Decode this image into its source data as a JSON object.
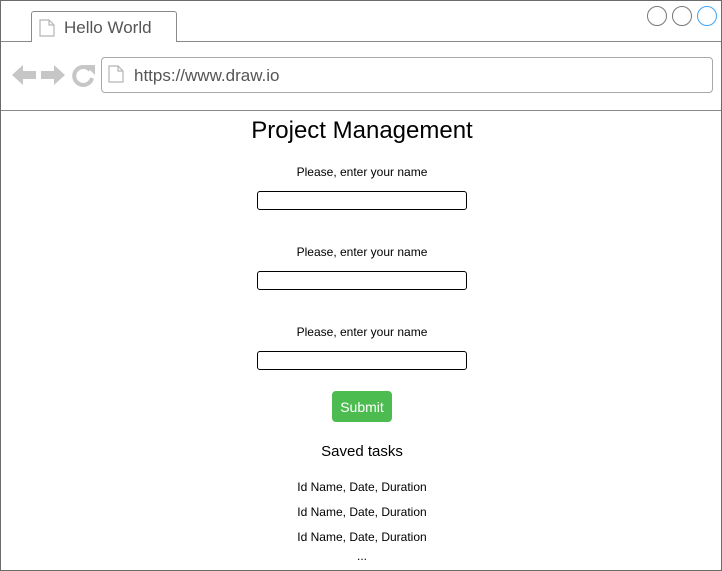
{
  "browser": {
    "tab_title": "Hello World",
    "url": "https://www.draw.io",
    "icons": {
      "tab": "document-icon",
      "back": "back-arrow-icon",
      "forward": "forward-arrow-icon",
      "reload": "reload-icon",
      "url": "document-icon"
    },
    "window_controls": [
      "minimize-button",
      "maximize-button",
      "close-button"
    ]
  },
  "page": {
    "title": "Project Management",
    "fields": [
      {
        "label": "Please, enter your name",
        "value": "",
        "placeholder": ""
      },
      {
        "label": "Please, enter your name",
        "value": "",
        "placeholder": ""
      },
      {
        "label": "Please, enter your name",
        "value": "",
        "placeholder": ""
      }
    ],
    "submit_label": "Submit",
    "saved_title": "Saved tasks",
    "tasks": [
      "Id Name, Date, Duration",
      "Id Name, Date, Duration",
      "Id Name, Date, Duration"
    ],
    "more_text": "..."
  },
  "colors": {
    "submit_bg": "#4cbb50",
    "close_ring": "#42a5f5",
    "border": "#8a8a8a"
  }
}
